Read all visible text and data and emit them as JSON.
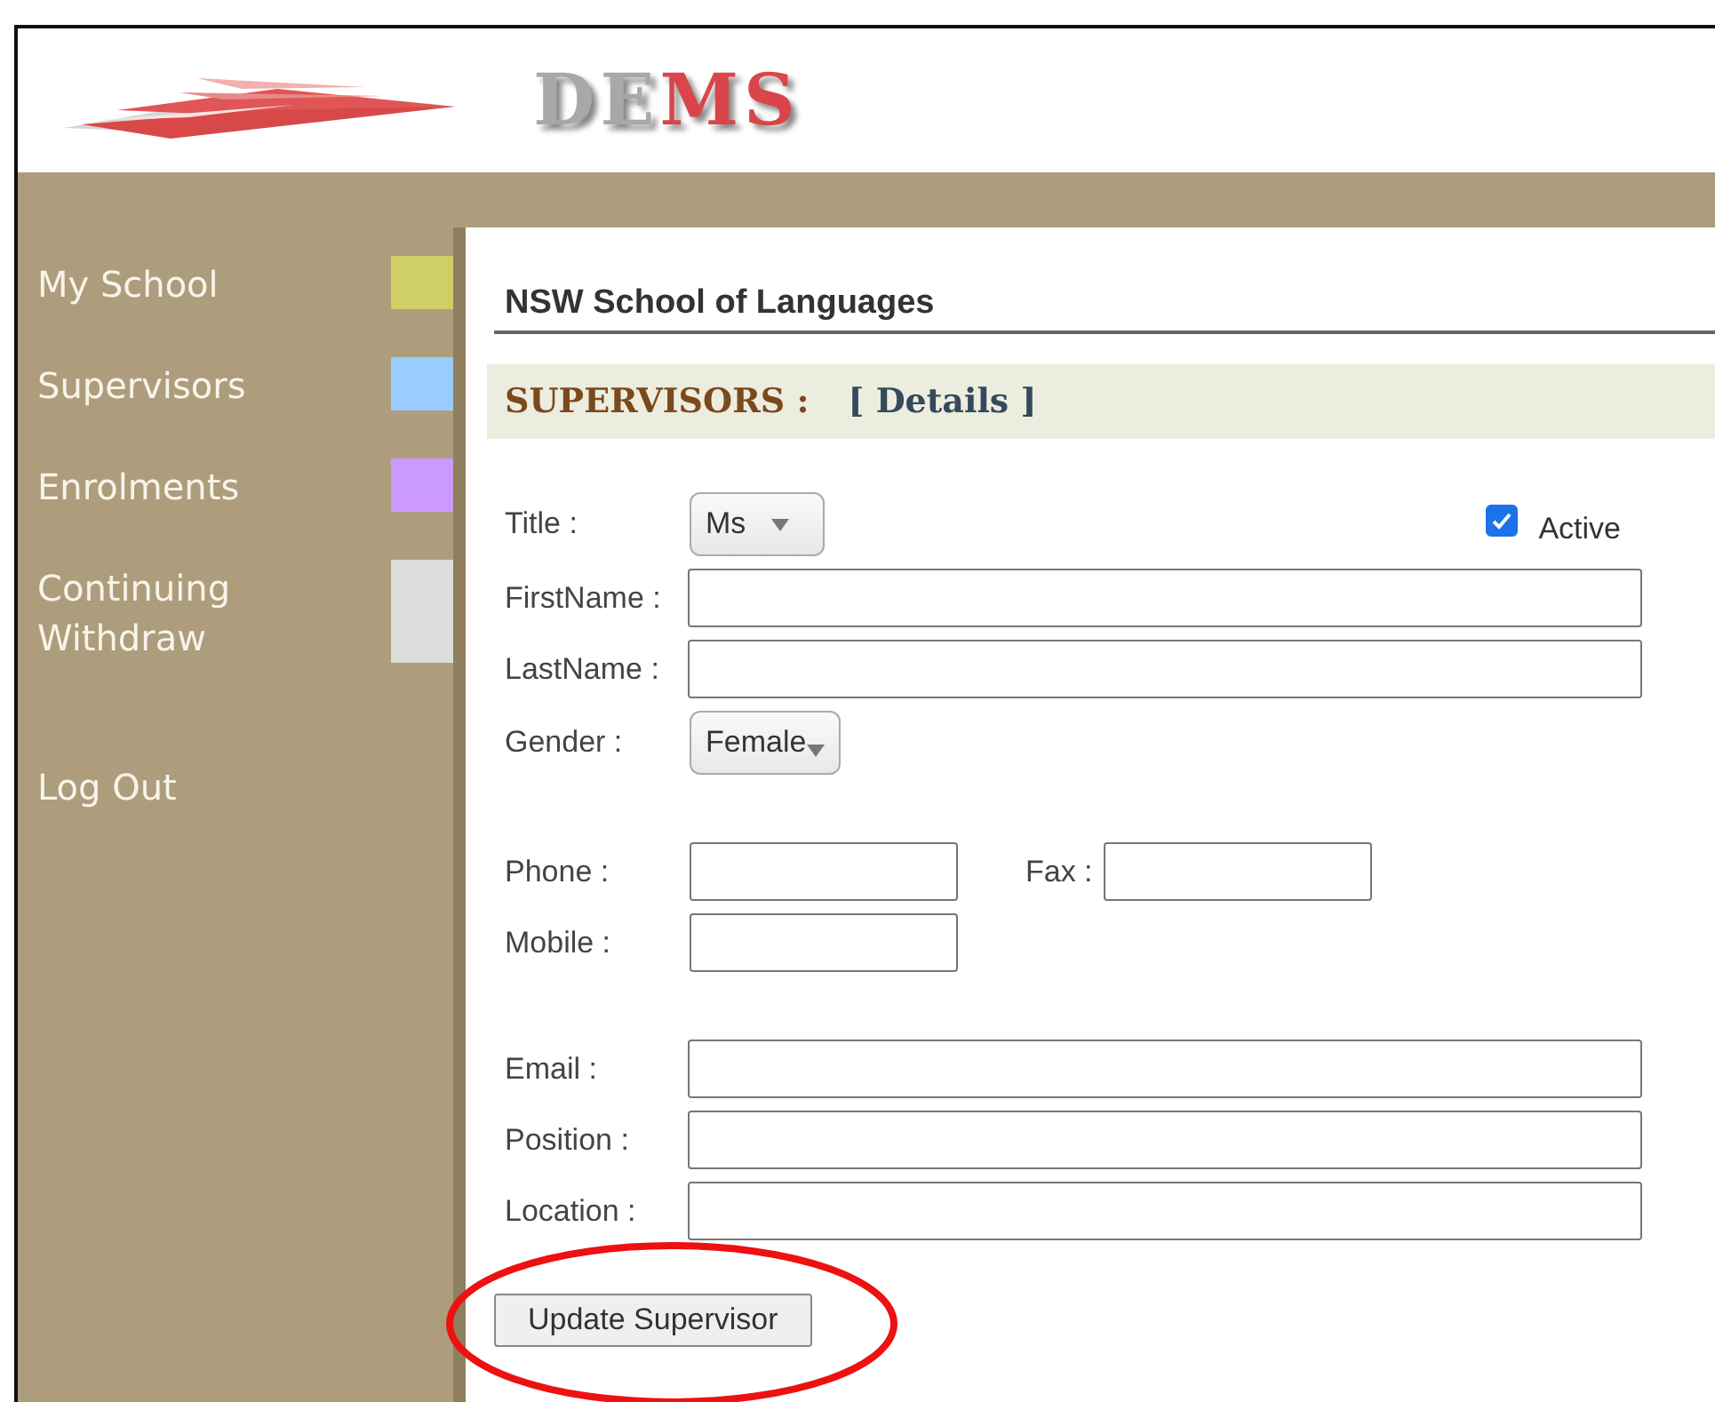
{
  "logo": [
    {
      "text": "DE",
      "kind": "plain"
    },
    {
      "text": "MS",
      "kind": "accent"
    }
  ],
  "sidebar": {
    "items": [
      {
        "label": "My School",
        "color": "#cfcf66"
      },
      {
        "label": "Supervisors",
        "color": "#99ccff"
      },
      {
        "label": "Enrolments",
        "color": "#cc99ff"
      },
      {
        "label": "Continuing Withdraw",
        "color": "#dddddd"
      }
    ],
    "logout": "Log Out"
  },
  "school": "NSW School of Languages",
  "section": {
    "title": "SUPERVISORS :",
    "subtitle": "[ Details ]"
  },
  "form": {
    "title": {
      "label": "Title :",
      "value": "Ms"
    },
    "active": {
      "label": "Active",
      "checked": true
    },
    "first_name": {
      "label": "FirstName :"
    },
    "last_name": {
      "label": "LastName :"
    },
    "gender": {
      "label": "Gender :",
      "value": "Female"
    },
    "phone": {
      "label": "Phone :"
    },
    "fax": {
      "label": "Fax :"
    },
    "mobile": {
      "label": "Mobile :"
    },
    "email": {
      "label": "Email :"
    },
    "position": {
      "label": "Position :"
    },
    "location": {
      "label": "Location :"
    }
  },
  "submit": "Update Supervisor"
}
